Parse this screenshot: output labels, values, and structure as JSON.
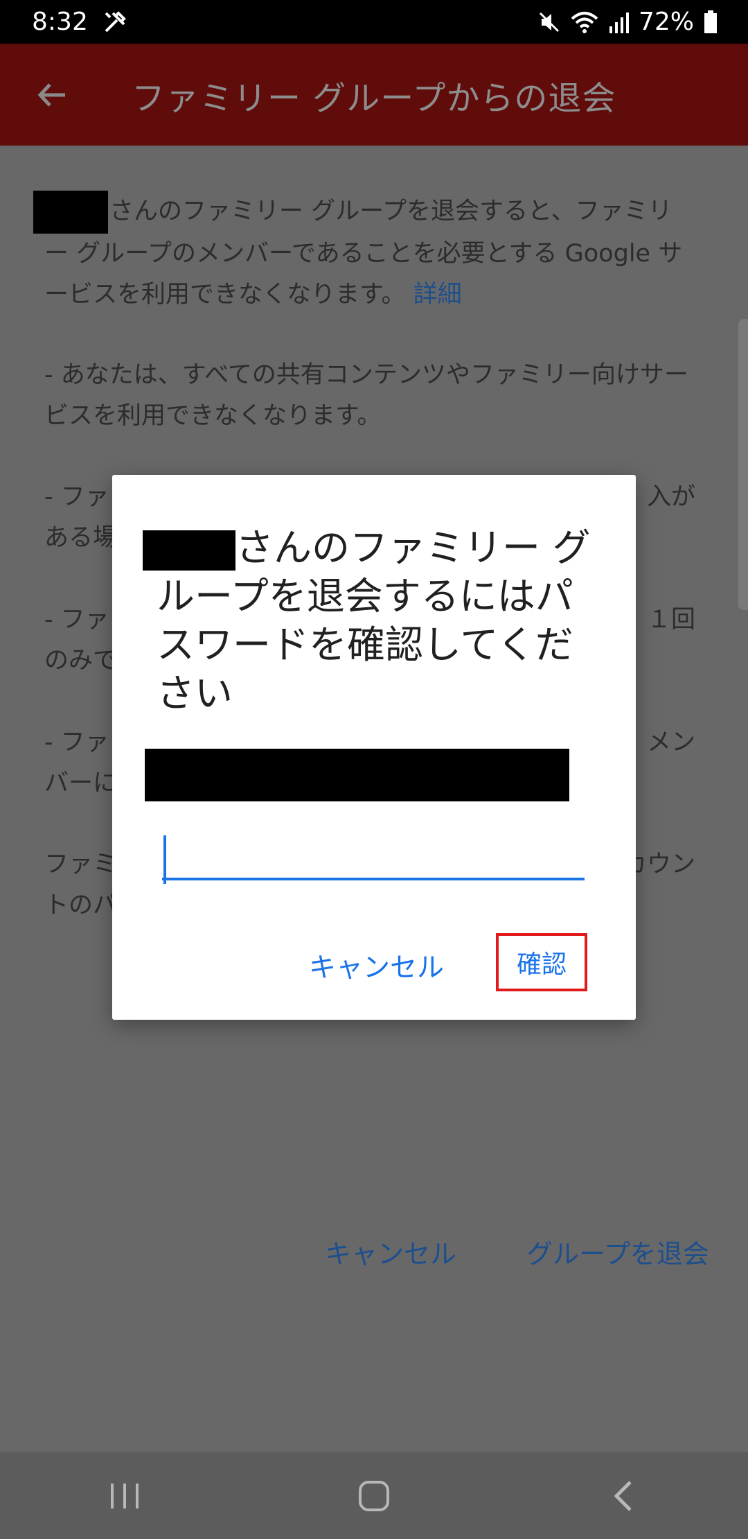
{
  "status_bar": {
    "time": "8:32",
    "battery": "72%",
    "icons": [
      "tools-icon",
      "mute-icon",
      "wifi-icon",
      "signal-icon",
      "battery-icon"
    ]
  },
  "app_bar": {
    "title": "ファミリー グループからの退会"
  },
  "content": {
    "intro": "さんのファミリー グループを退会すると、ファミリー グループのメンバーであることを必要とする Google サービスを利用できなくなります。",
    "intro_link": "詳細",
    "bullet1": "- あなたは、すべての共有コンテンツやファミリー向けサービスを利用できなくなります。",
    "bullet2_line1_start": "- ファ",
    "bullet2_line1_end": "入が",
    "bullet2_line2_start": "ある場",
    "bullet3_line1_start": "- ファ",
    "bullet3_line1_end": "１回",
    "bullet3_line2_start": "のみで",
    "bullet4_line1_start": "- ファ",
    "bullet4_line1_end": "メン",
    "bullet4_line2_start": "バーに",
    "footer_line1_start": "ファミ",
    "footer_line1_end": "カウン",
    "footer_line2_start": "トのパ",
    "cancel_label": "キャンセル",
    "leave_label": "グループを退会"
  },
  "dialog": {
    "title": "さんのファミリー グループを退会するにはパスワードを確認してください",
    "password_value": "",
    "cancel_label": "キャンセル",
    "confirm_label": "確認"
  },
  "colors": {
    "accent": "#1a73e8",
    "highlight_border": "#e11b1b",
    "app_bar": "#5f0c0a"
  },
  "nav_bar": {
    "icons": [
      "recent-apps-icon",
      "home-icon",
      "back-icon"
    ]
  }
}
